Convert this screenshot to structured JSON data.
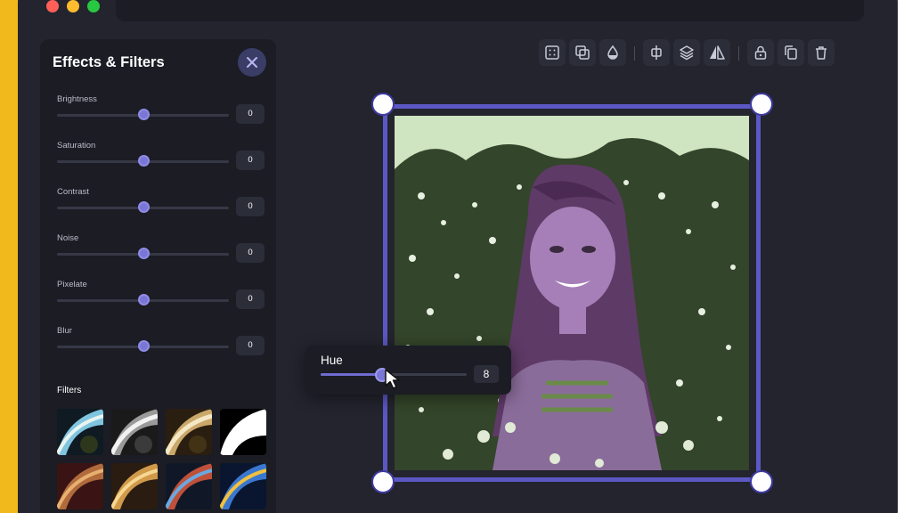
{
  "panel": {
    "title": "Effects & Filters",
    "sliders": [
      {
        "label": "Brightness",
        "value": "0",
        "position": 0.5
      },
      {
        "label": "Saturation",
        "value": "0",
        "position": 0.5
      },
      {
        "label": "Contrast",
        "value": "0",
        "position": 0.5
      },
      {
        "label": "Noise",
        "value": "0",
        "position": 0.5
      },
      {
        "label": "Pixelate",
        "value": "0",
        "position": 0.5
      },
      {
        "label": "Blur",
        "value": "0",
        "position": 0.5
      }
    ],
    "filters_title": "Filters"
  },
  "toolbar": {
    "icons": [
      "grid-icon",
      "duplicate-layer-icon",
      "opacity-icon",
      "align-center-icon",
      "layers-icon",
      "flip-icon",
      "lock-icon",
      "copy-icon",
      "delete-icon"
    ]
  },
  "hue": {
    "label": "Hue",
    "value": "8",
    "position": 0.42
  },
  "colors": {
    "accent": "#5b58c4",
    "window": "#23242e",
    "panel": "#1b1c24",
    "brand_yellow": "#f2b91d"
  }
}
